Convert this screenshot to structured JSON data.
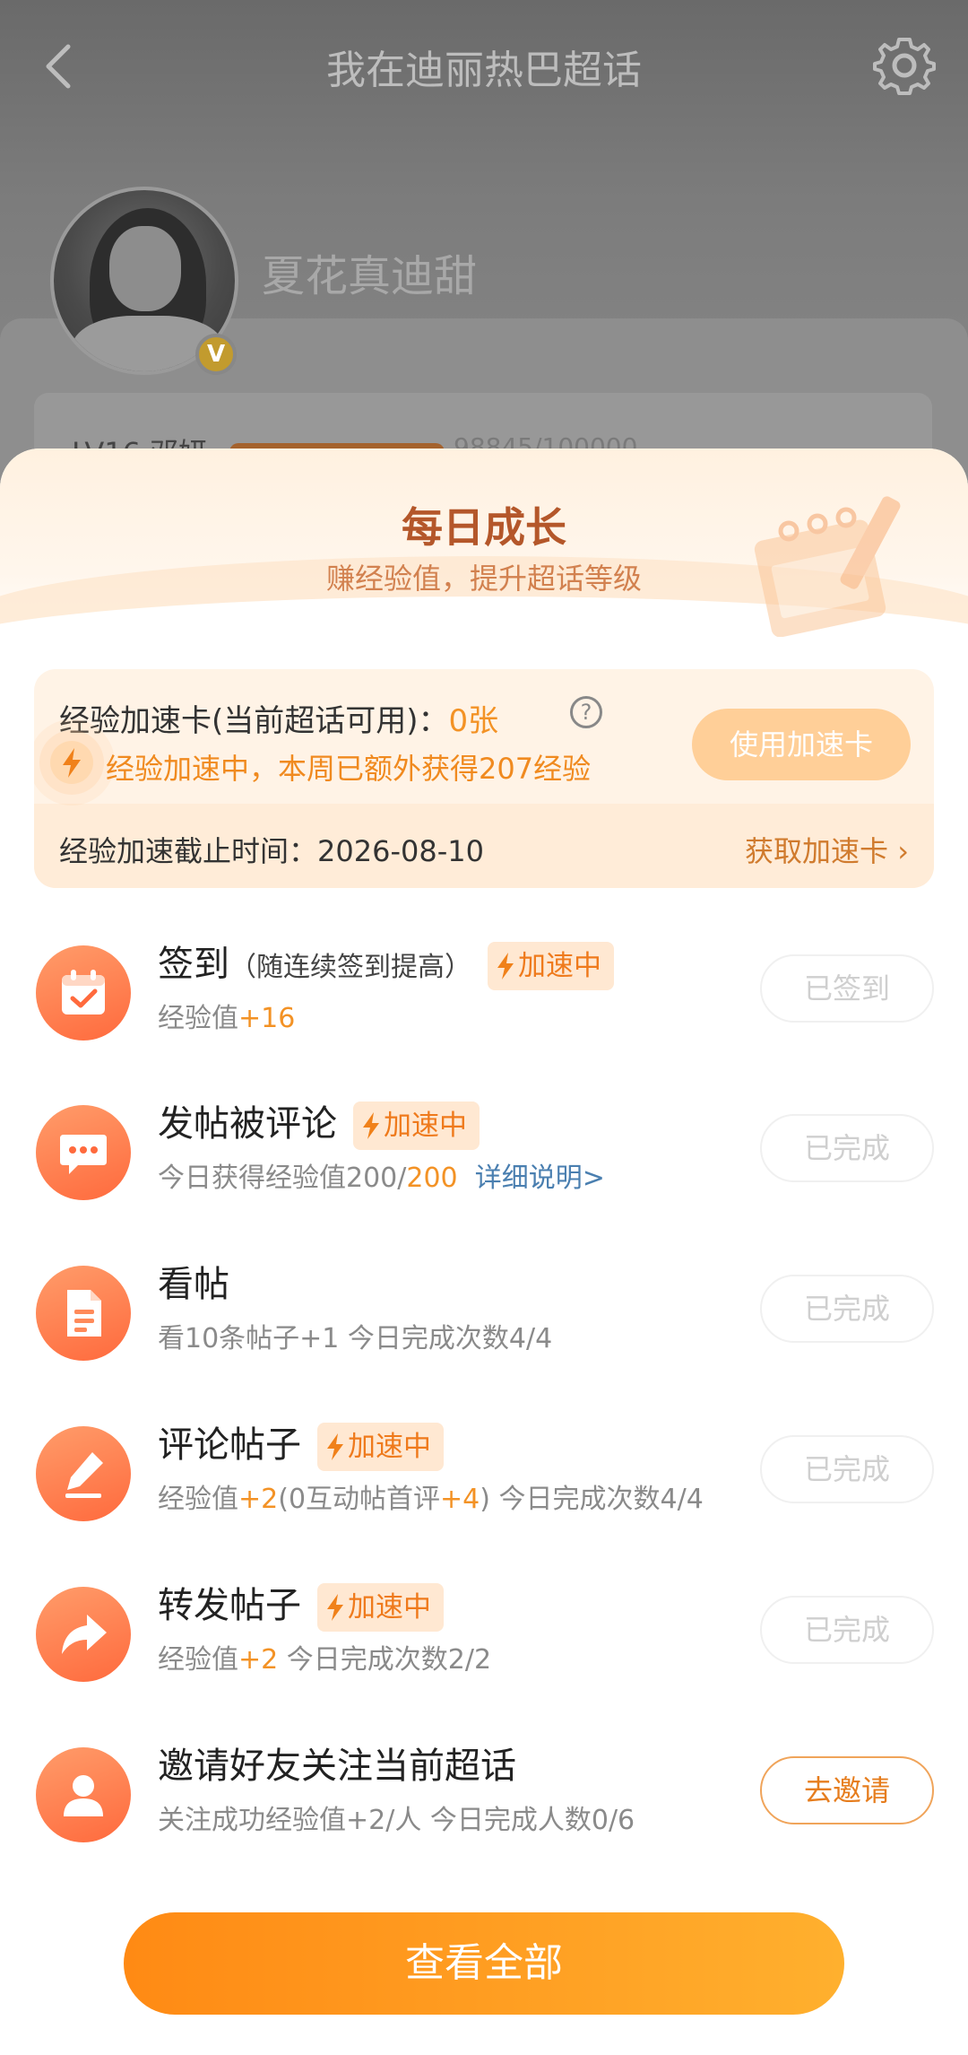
{
  "colors": {
    "accent": "#f39225",
    "button_gradient_start": "#ff8a14",
    "button_gradient_end": "#ffb02e",
    "icon_gradient": "#ff6a3d"
  },
  "header": {
    "title": "我在迪丽热巴超话",
    "back_icon": "chevron-left-icon",
    "settings_icon": "gear-icon"
  },
  "profile": {
    "username": "夏花真迪甜",
    "level": "LV16 邓妍",
    "progress_text": "98845/100000",
    "progress": 0.988
  },
  "sheet": {
    "title": "每日成长",
    "subtitle": "赚经验值，提升超话等级",
    "boost": {
      "label": "经验加速卡(当前超话可用)：",
      "count": "0张",
      "help": "?",
      "status": "经验加速中，本周已额外获得207经验",
      "use_button": "使用加速卡",
      "deadline": "经验加速截止时间：2026-08-10",
      "get_link": "获取加速卡"
    },
    "accel_tag": "加速中",
    "tasks": [
      {
        "name": "签到",
        "note": "（随连续签到提高）",
        "accelerated": true,
        "desc_a": "经验值",
        "desc_b": "+16",
        "button": "已签到",
        "icon": "calendar-check-icon"
      },
      {
        "name": "发帖被评论",
        "accelerated": true,
        "desc_a": "今日获得经验值200/",
        "desc_b": "200",
        "link": "详细说明>",
        "button": "已完成",
        "icon": "chat-bubble-icon"
      },
      {
        "name": "看帖",
        "desc_a": "看10条帖子+1   今日完成次数4/4",
        "button": "已完成",
        "icon": "document-icon"
      },
      {
        "name": "评论帖子",
        "accelerated": true,
        "desc_a": "经验值",
        "desc_b": "+2",
        "desc_c": "(0互动帖首评",
        "desc_d": "+4",
        "desc_e": ")   今日完成次数4/4",
        "button": "已完成",
        "icon": "pen-icon"
      },
      {
        "name": "转发帖子",
        "accelerated": true,
        "desc_a": "经验值",
        "desc_b": "+2",
        "desc_c": "   今日完成次数2/2",
        "button": "已完成",
        "icon": "share-arrow-icon"
      },
      {
        "name": "邀请好友关注当前超话",
        "desc_a": "关注成功经验值+2/人   今日完成人数0/6",
        "button": "去邀请",
        "icon": "person-icon"
      }
    ],
    "view_all": "查看全部"
  }
}
